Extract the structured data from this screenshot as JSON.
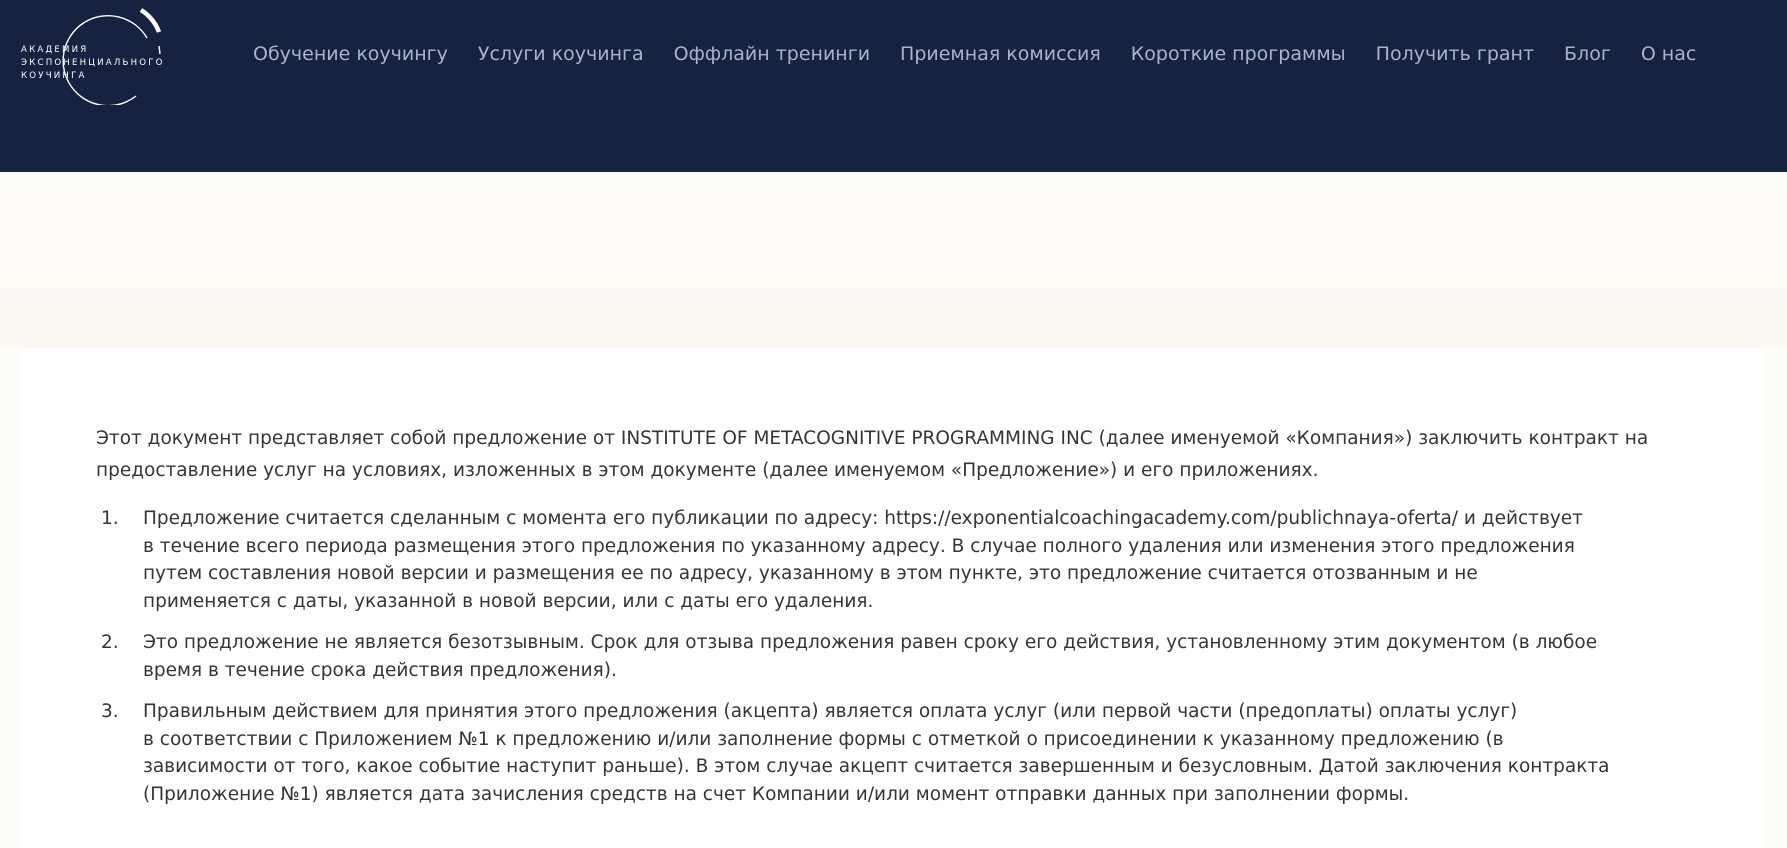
{
  "logo": {
    "lines": [
      "АКАДЕМИЯ",
      "ЭКСПОНЕНЦИАЛЬНОГО",
      "КОУЧИНГА"
    ]
  },
  "nav": {
    "items": [
      "Обучение коучингу",
      "Услуги коучинга",
      "Оффлайн тренинги",
      "Приемная комиссия",
      "Короткие программы",
      "Получить грант",
      "Блог",
      "О нас"
    ]
  },
  "colors": {
    "header_bg": "#16223f",
    "nav_text": "#a9b4c9",
    "page_bg": "#fefcf9",
    "card_bg": "#ffffff",
    "body_text": "#33353a"
  },
  "document": {
    "intro": "Этот документ представляет собой предложение от INSTITUTE OF METACOGNITIVE PROGRAMMING INC (далее именуемой «Компания») заключить контракт на предоставление услуг на условиях, изложенных в этом документе (далее именуемом «Предложение») и его приложениях.",
    "clauses": [
      {
        "num": "1.",
        "lines": [
          "Предложение считается сделанным с момента его публикации по адресу: https://exponentialcoachingacademy.com/publichnaya-oferta/ и действует",
          "в течение всего периода размещения этого предложения по указанному адресу. В случае полного удаления или изменения этого предложения",
          "путем составления новой версии и размещения ее по адресу, указанному в этом пункте, это предложение считается отозванным и не",
          "применяется с даты, указанной в новой версии, или с даты его удаления."
        ]
      },
      {
        "num": "2.",
        "lines": [
          "Это предложение не является безотзывным. Срок для отзыва предложения равен сроку его действия, установленному этим документом (в любое",
          "время в течение срока действия предложения)."
        ]
      },
      {
        "num": "3.",
        "lines": [
          "Правильным действием для принятия этого предложения (акцепта) является оплата услуг (или первой части (предоплаты) оплаты услуг)",
          "в соответствии с Приложением №1 к предложению и/или заполнение формы с отметкой о присоединении к указанному предложению (в",
          "зависимости от того, какое событие наступит раньше). В этом случае акцепт считается завершенным и безусловным. Датой заключения контракта",
          "(Приложение №1) является дата зачисления средств на счет Компании и/или момент отправки данных при заполнении формы."
        ]
      }
    ]
  }
}
